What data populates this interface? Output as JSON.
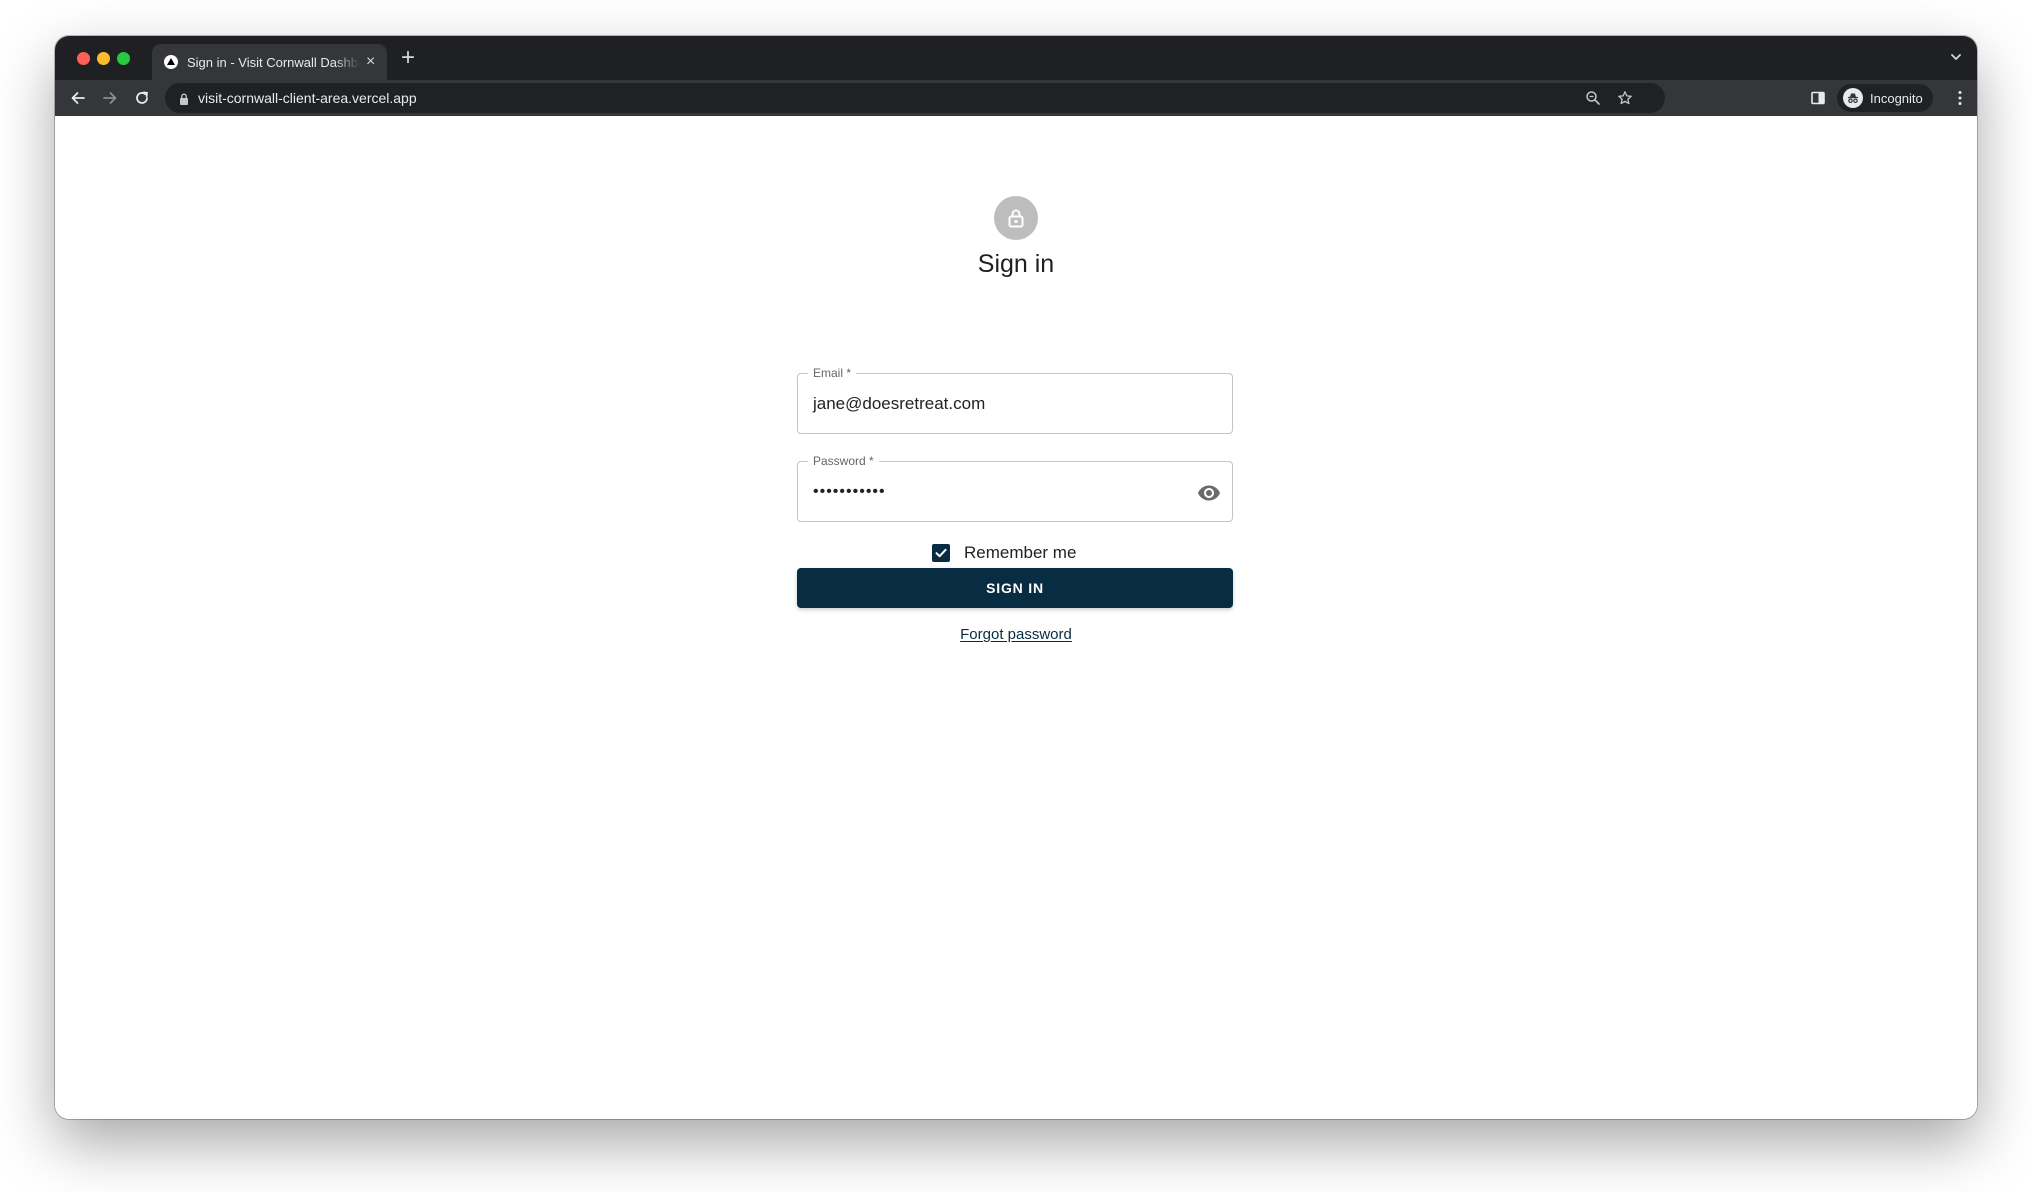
{
  "browser": {
    "tab_title": "Sign in - Visit Cornwall Dashboard",
    "url": "visit-cornwall-client-area.vercel.app",
    "profile_label": "Incognito"
  },
  "form": {
    "heading": "Sign in",
    "email_label": "Email *",
    "email_value": "jane@doesretreat.com",
    "password_label": "Password *",
    "password_value": "•••••••••••",
    "remember_label": "Remember me",
    "remember_checked": true,
    "signin_label": "SIGN IN",
    "forgot_label": "Forgot password"
  },
  "colors": {
    "primary": "#082d42",
    "avatar_bg": "#bdbdbd",
    "chrome_dark": "#1f2023",
    "chrome_toolbar": "#35363a"
  },
  "icons": {
    "avatar": "lock-icon",
    "password_toggle": "eye-icon",
    "checkbox": "checkmark-icon"
  }
}
